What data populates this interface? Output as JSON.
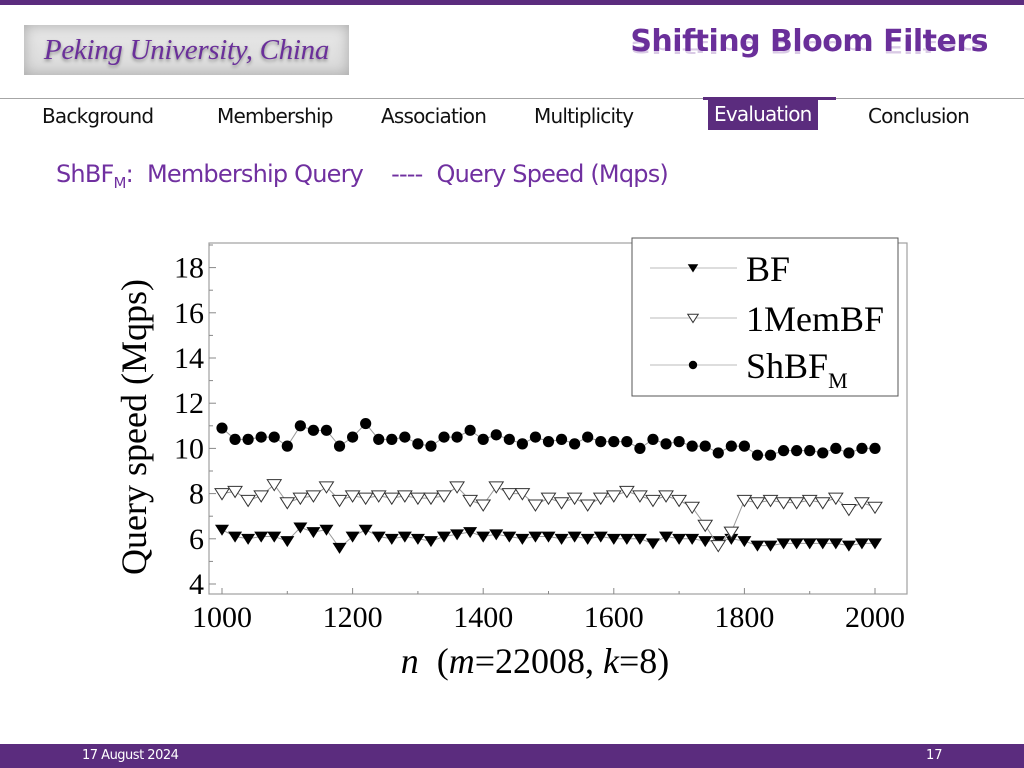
{
  "header": {
    "logo_text": "Peking University, China",
    "title": "Shifting Bloom Filters"
  },
  "nav": {
    "items": [
      {
        "label": "Background",
        "active": false
      },
      {
        "label": "Membership",
        "active": false
      },
      {
        "label": "Association",
        "active": false
      },
      {
        "label": "Multiplicity",
        "active": false
      },
      {
        "label": "Evaluation",
        "active": true
      },
      {
        "label": "Conclusion",
        "active": false
      }
    ]
  },
  "slide": {
    "subtitle_prefix": "ShBF",
    "subtitle_prefix_sub": "M",
    "subtitle_colon": ":",
    "subtitle_main": "Membership Query",
    "subtitle_sep": "----",
    "subtitle_metric": "Query Speed (Mqps)"
  },
  "footer": {
    "date": "17 August 2024",
    "page": "17"
  },
  "colors": {
    "brand_purple": "#5b2c7e",
    "title_purple": "#6a2f9a",
    "subtitle_purple": "#7030a0"
  },
  "chart_data": {
    "type": "line",
    "title": "",
    "xlabel": "n  (m=22008, k=8)",
    "xlabel_parts": {
      "n": "n",
      "open": "  (",
      "m": "m",
      "m_val": "=22008, ",
      "k": "k",
      "k_val": "=8)"
    },
    "ylabel": "Query speed  (Mqps)",
    "xlim": [
      1000,
      2000
    ],
    "ylim": [
      4,
      19
    ],
    "xticks": [
      1000,
      1200,
      1400,
      1600,
      1800,
      2000
    ],
    "yticks": [
      4,
      6,
      8,
      10,
      12,
      14,
      16,
      18
    ],
    "grid": false,
    "legend_position": "top-right",
    "x": [
      1000,
      1020,
      1040,
      1060,
      1080,
      1100,
      1120,
      1140,
      1160,
      1180,
      1200,
      1220,
      1240,
      1260,
      1280,
      1300,
      1320,
      1340,
      1360,
      1380,
      1400,
      1420,
      1440,
      1460,
      1480,
      1500,
      1520,
      1540,
      1560,
      1580,
      1600,
      1620,
      1640,
      1660,
      1680,
      1700,
      1720,
      1740,
      1760,
      1780,
      1800,
      1820,
      1840,
      1860,
      1880,
      1900,
      1920,
      1940,
      1960,
      1980,
      2000
    ],
    "series": [
      {
        "name": "BF",
        "legend_label": "BF",
        "marker": "triangle-down-filled",
        "values": [
          6.4,
          6.1,
          6.0,
          6.1,
          6.1,
          5.9,
          6.5,
          6.3,
          6.4,
          5.6,
          6.1,
          6.4,
          6.1,
          6.0,
          6.1,
          6.0,
          5.9,
          6.1,
          6.2,
          6.3,
          6.1,
          6.2,
          6.1,
          6.0,
          6.1,
          6.1,
          6.0,
          6.1,
          6.0,
          6.1,
          6.0,
          6.0,
          6.0,
          5.8,
          6.1,
          6.0,
          6.0,
          5.9,
          5.9,
          6.0,
          5.9,
          5.7,
          5.7,
          5.8,
          5.8,
          5.8,
          5.8,
          5.8,
          5.7,
          5.8,
          5.8
        ]
      },
      {
        "name": "1MemBF",
        "legend_label": "1MemBF",
        "marker": "triangle-down-open",
        "values": [
          8.0,
          8.1,
          7.7,
          7.9,
          8.4,
          7.6,
          7.8,
          7.9,
          8.3,
          7.7,
          7.9,
          7.8,
          7.9,
          7.8,
          7.9,
          7.8,
          7.8,
          7.9,
          8.3,
          7.7,
          7.5,
          8.3,
          8.0,
          8.0,
          7.5,
          7.8,
          7.6,
          7.8,
          7.5,
          7.8,
          7.9,
          8.1,
          7.9,
          7.7,
          7.9,
          7.7,
          7.4,
          6.6,
          5.7,
          6.3,
          7.7,
          7.6,
          7.7,
          7.6,
          7.6,
          7.7,
          7.6,
          7.8,
          7.3,
          7.6,
          7.4
        ]
      },
      {
        "name": "ShBF_M",
        "legend_label": "ShBF",
        "legend_sub": "M",
        "marker": "circle-filled",
        "values": [
          10.9,
          10.4,
          10.4,
          10.5,
          10.5,
          10.1,
          11.0,
          10.8,
          10.8,
          10.1,
          10.5,
          11.1,
          10.4,
          10.4,
          10.5,
          10.2,
          10.1,
          10.5,
          10.5,
          10.8,
          10.4,
          10.6,
          10.4,
          10.2,
          10.5,
          10.3,
          10.4,
          10.2,
          10.5,
          10.3,
          10.3,
          10.3,
          10.0,
          10.4,
          10.2,
          10.3,
          10.1,
          10.1,
          9.8,
          10.1,
          10.1,
          9.7,
          9.7,
          9.9,
          9.9,
          9.9,
          9.8,
          10.0,
          9.8,
          10.0,
          10.0
        ]
      }
    ]
  }
}
